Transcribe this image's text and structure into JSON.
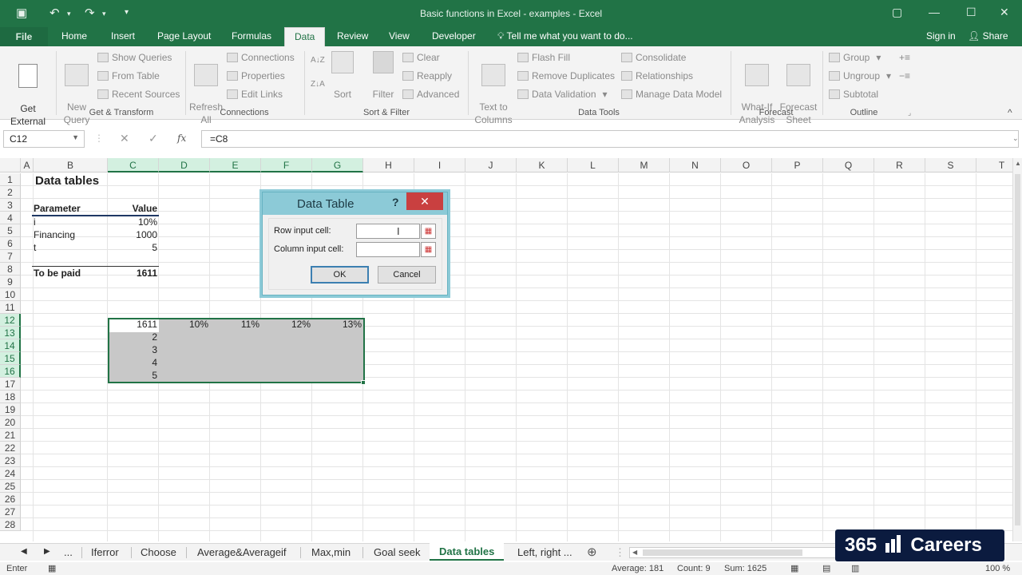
{
  "window": {
    "title": "Basic functions in Excel - examples - Excel",
    "signin": "Sign in",
    "share": "Share"
  },
  "tabs": {
    "file": "File",
    "items": [
      "Home",
      "Insert",
      "Page Layout",
      "Formulas",
      "Data",
      "Review",
      "View",
      "Developer"
    ],
    "tell_me": "Tell me what you want to do..."
  },
  "ribbon": {
    "get_external_data": "Get External\nData",
    "new_query": "New\nQuery",
    "show_queries": "Show Queries",
    "from_table": "From Table",
    "recent_sources": "Recent Sources",
    "group_get_transform": "Get & Transform",
    "refresh_all": "Refresh\nAll",
    "connections": "Connections",
    "properties": "Properties",
    "edit_links": "Edit Links",
    "group_connections": "Connections",
    "sort": "Sort",
    "filter": "Filter",
    "clear": "Clear",
    "reapply": "Reapply",
    "advanced": "Advanced",
    "group_sort_filter": "Sort & Filter",
    "text_to_columns": "Text to\nColumns",
    "flash_fill": "Flash Fill",
    "remove_duplicates": "Remove Duplicates",
    "data_validation": "Data Validation",
    "consolidate": "Consolidate",
    "relationships": "Relationships",
    "manage_data_model": "Manage Data Model",
    "group_data_tools": "Data Tools",
    "what_if": "What-If\nAnalysis",
    "forecast_sheet": "Forecast\nSheet",
    "group_forecast": "Forecast",
    "group_btn": "Group",
    "ungroup": "Ungroup",
    "subtotal": "Subtotal",
    "group_outline": "Outline"
  },
  "formula_bar": {
    "name_box": "C12",
    "fx": "fx",
    "formula": "=C8"
  },
  "grid": {
    "columns": [
      "A",
      "B",
      "C",
      "D",
      "E",
      "F",
      "G",
      "H",
      "I",
      "J",
      "K",
      "L",
      "M",
      "N",
      "O",
      "P",
      "Q",
      "R",
      "S",
      "T"
    ],
    "rows": [
      "1",
      "2",
      "3",
      "4",
      "5",
      "6",
      "7",
      "8",
      "9",
      "10",
      "11",
      "12",
      "13",
      "14",
      "15",
      "16",
      "17",
      "18",
      "19",
      "20",
      "21",
      "22",
      "23",
      "24",
      "25",
      "26",
      "27",
      "28"
    ],
    "cells": {
      "title": "Data tables",
      "param_header": "Parameter",
      "value_header": "Value",
      "i_label": "i",
      "i_value": "10%",
      "financing_label": "Financing",
      "financing_value": "1000",
      "t_label": "t",
      "t_value": "5",
      "paid_label": "To be paid",
      "paid_value": "1611",
      "c12": "1611",
      "d12": "10%",
      "e12": "11%",
      "f12": "12%",
      "g12": "13%",
      "c13": "2",
      "c14": "3",
      "c15": "4",
      "c16": "5"
    }
  },
  "dialog": {
    "title": "Data Table",
    "help": "?",
    "close": "✕",
    "row_input_label": "Row input cell:",
    "column_input_label": "Column input cell:",
    "row_input_value": "",
    "column_input_value": "",
    "ok": "OK",
    "cancel": "Cancel"
  },
  "sheet_tabs": {
    "more": "...",
    "tabs": [
      "Iferror",
      "Choose",
      "Average&Averageif",
      "Max,min",
      "Goal seek",
      "Data tables",
      "Left, right ..."
    ],
    "active": "Data tables"
  },
  "status": {
    "mode": "Enter",
    "average": "Average: 181",
    "count": "Count: 9",
    "sum": "Sum: 1625",
    "zoom": "100 %"
  },
  "brand": {
    "text_left": "365",
    "text_right": "Careers"
  },
  "colors": {
    "excel_green": "#217346",
    "dialog_title": "#8ccad7",
    "close_red": "#c94040",
    "selection_fill": "#c8c8c8"
  }
}
